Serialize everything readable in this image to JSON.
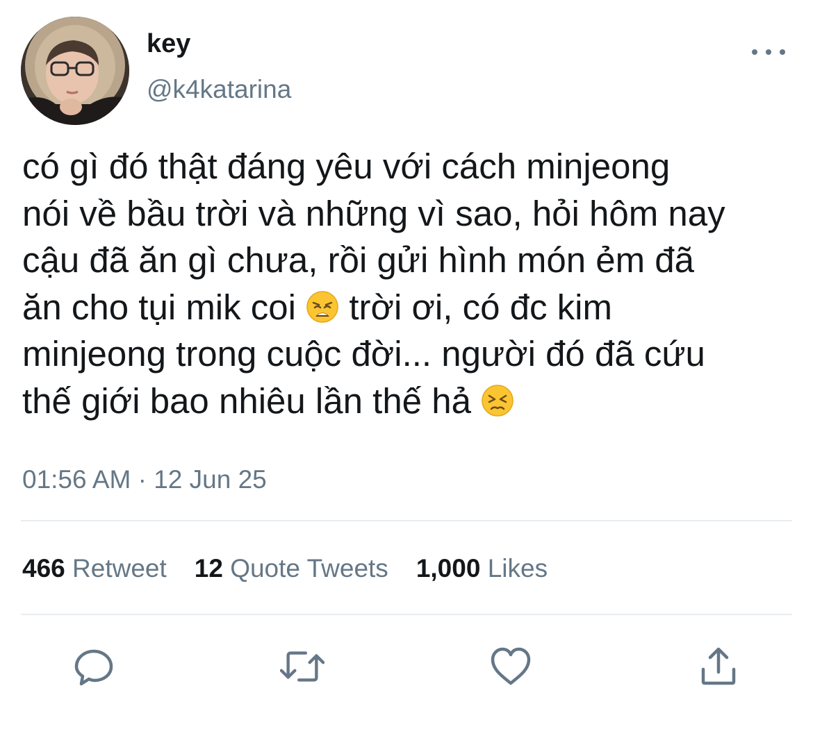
{
  "author": {
    "display_name": "key",
    "handle": "@k4katarina"
  },
  "tweet": {
    "text_part1": "có gì đó thật đáng yêu với cách minjeong\nnói về bầu trời và những vì sao, hỏi hôm nay\ncậu đã ăn gì chưa, rồi gửi hình món ẻm đã\năn cho tụi mik coi ",
    "emoji1": "weary-face",
    "text_part2": "  trời ơi, có đc kim\nminjeong trong cuộc đời... người đó đã cứu\nthế giới bao nhiêu lần thế hả ",
    "emoji2": "persevering-face",
    "timestamp": "01:56 AM · 12 Jun 25"
  },
  "stats": {
    "retweets_count": "466",
    "retweets_label": "Retweet",
    "quotes_count": "12",
    "quotes_label": "Quote Tweets",
    "likes_count": "1,000",
    "likes_label": "Likes"
  },
  "actions": [
    "reply-icon",
    "retweet-icon",
    "like-icon",
    "share-icon"
  ],
  "colors": {
    "text": "#14171a",
    "secondary": "#657786",
    "divider": "#e6ecf0"
  }
}
